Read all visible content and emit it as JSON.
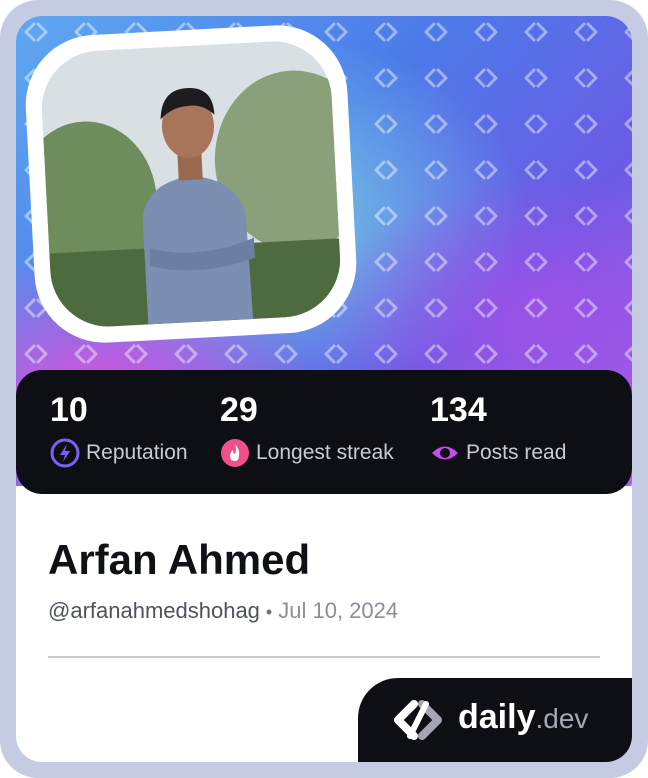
{
  "profile": {
    "name": "Arfan Ahmed",
    "handle": "@arfanahmedshohag",
    "separator": "•",
    "joined": "Jul 10, 2024"
  },
  "stats": [
    {
      "value": "10",
      "label": "Reputation",
      "icon": "lightning-icon",
      "color": "#7b61f0"
    },
    {
      "value": "29",
      "label": "Longest streak",
      "icon": "flame-icon",
      "color": "#f0508a"
    },
    {
      "value": "134",
      "label": "Posts read",
      "icon": "eye-icon",
      "color": "#c64bf0"
    }
  ],
  "brand": {
    "main": "daily",
    "suffix": ".dev"
  },
  "colors": {
    "frame": "#c4cbe2",
    "panel": "#0e0f14",
    "accent_purple": "#b35be8"
  }
}
